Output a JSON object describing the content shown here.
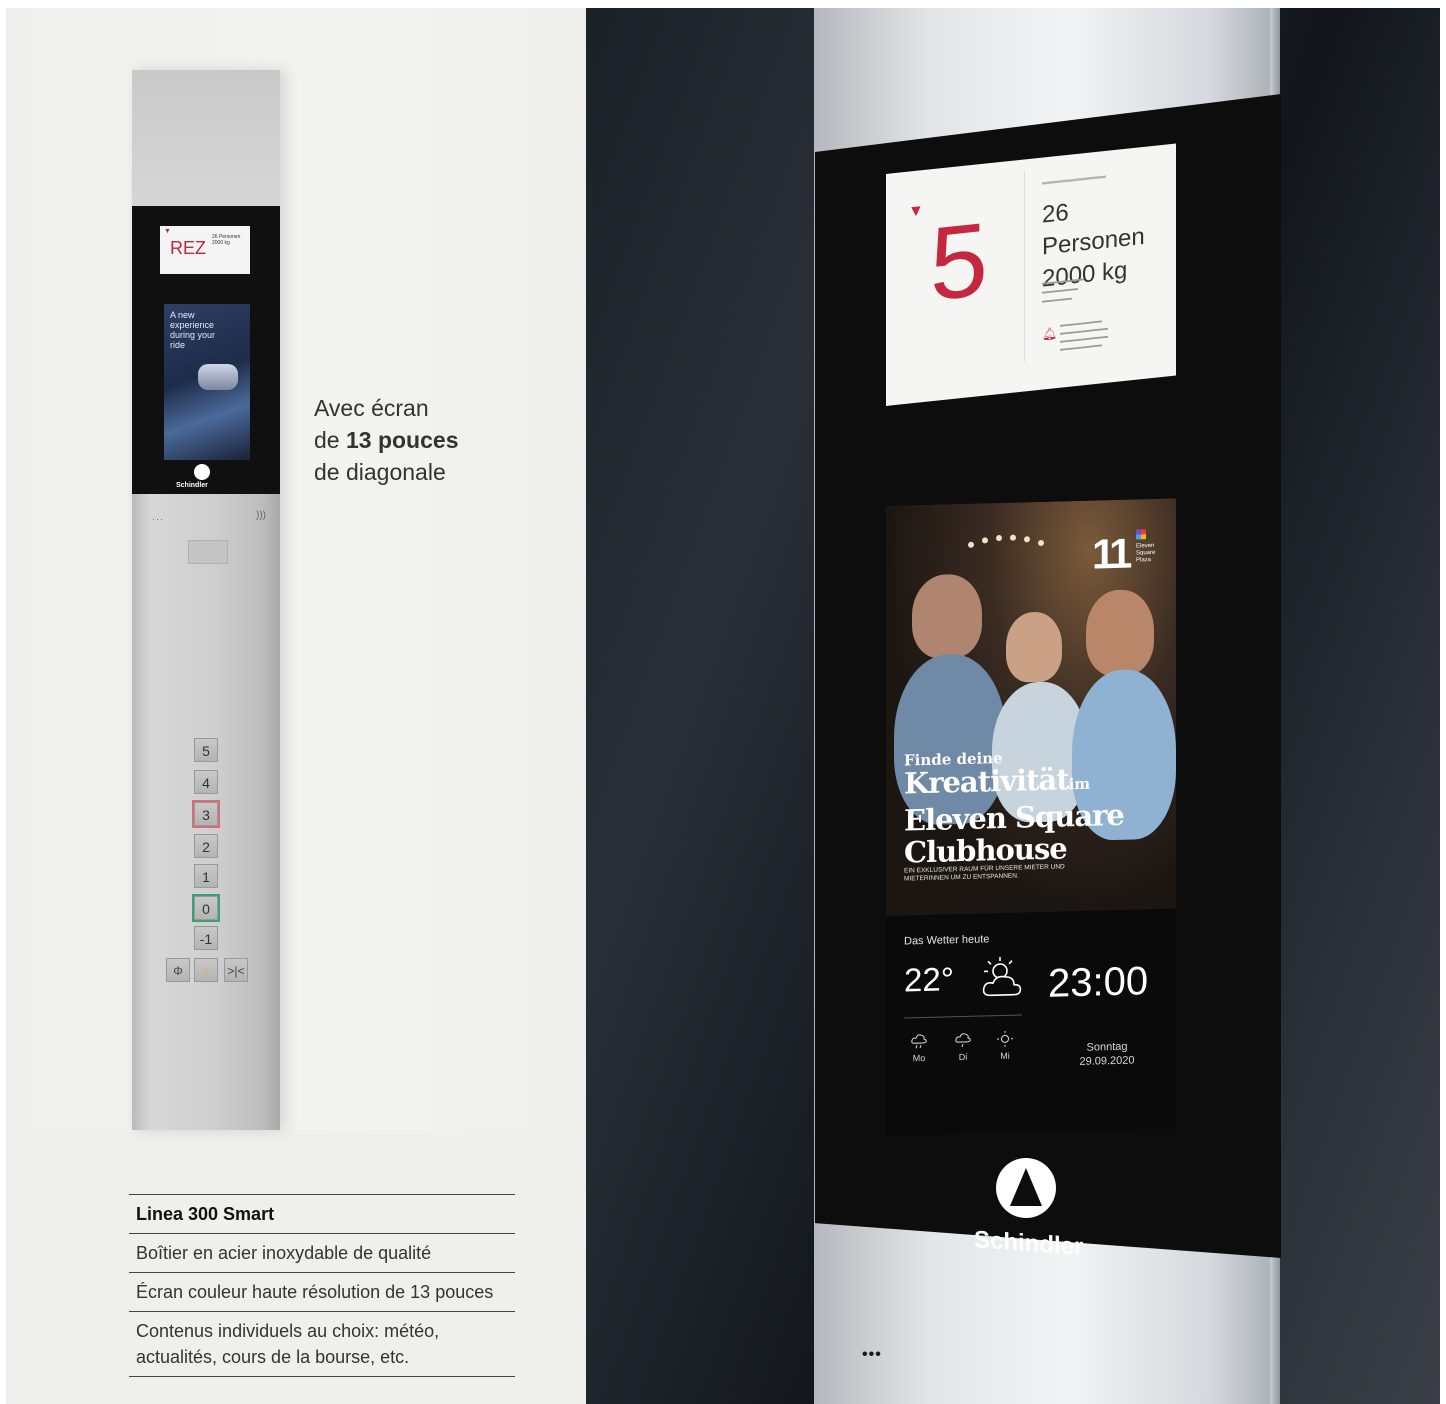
{
  "left_panel": {
    "mini_screen": {
      "floor": "REZ",
      "capacity": "26 Personen\n2000 kg",
      "ad_text": "A new experience during your ride",
      "brand": "Schindler"
    },
    "buttons": [
      "5",
      "4",
      "3",
      "2",
      "1",
      "0",
      "-1"
    ],
    "special_buttons": [
      "Φ",
      "⍾",
      ">|<"
    ],
    "caption": {
      "line1": "Avec écran",
      "prefix": "de ",
      "bold": "13 pouces",
      "line3": "de diagonale"
    },
    "spec_table": {
      "title": "Linea 300 Smart",
      "rows": [
        "Boîtier en acier inoxydable de qualité",
        "Écran couleur haute résolution de 13 pouces",
        "Contenus individuels au choix: météo, actualités, cours de la bourse, etc."
      ]
    }
  },
  "right_panel": {
    "indicator": {
      "floor": "5",
      "capacity_line1": "26 Personen",
      "capacity_line2": "2000 kg"
    },
    "ad": {
      "kicker": "Finde deine",
      "headline_1": "Kreativität",
      "headline_im": "im",
      "headline_2": "Eleven Square",
      "headline_3": "Clubhouse",
      "sub": "EIN EXKLUSIVER RAUM FÜR UNSERE MIETER UND MIETERINNEN UM ZU ENTSPANNEN.",
      "brand_number": "11",
      "brand_name": "Eleven Square Plaza"
    },
    "weather": {
      "label": "Das Wetter heute",
      "temperature": "22°",
      "time": "23:00",
      "days": [
        "Mo",
        "Di",
        "Mi"
      ],
      "weekday": "Sonntag",
      "date": "29.09.2020"
    },
    "logo_text": "Schindler"
  },
  "colors": {
    "indicator_red": "#c5283e",
    "panel_bg": "#efefed"
  }
}
